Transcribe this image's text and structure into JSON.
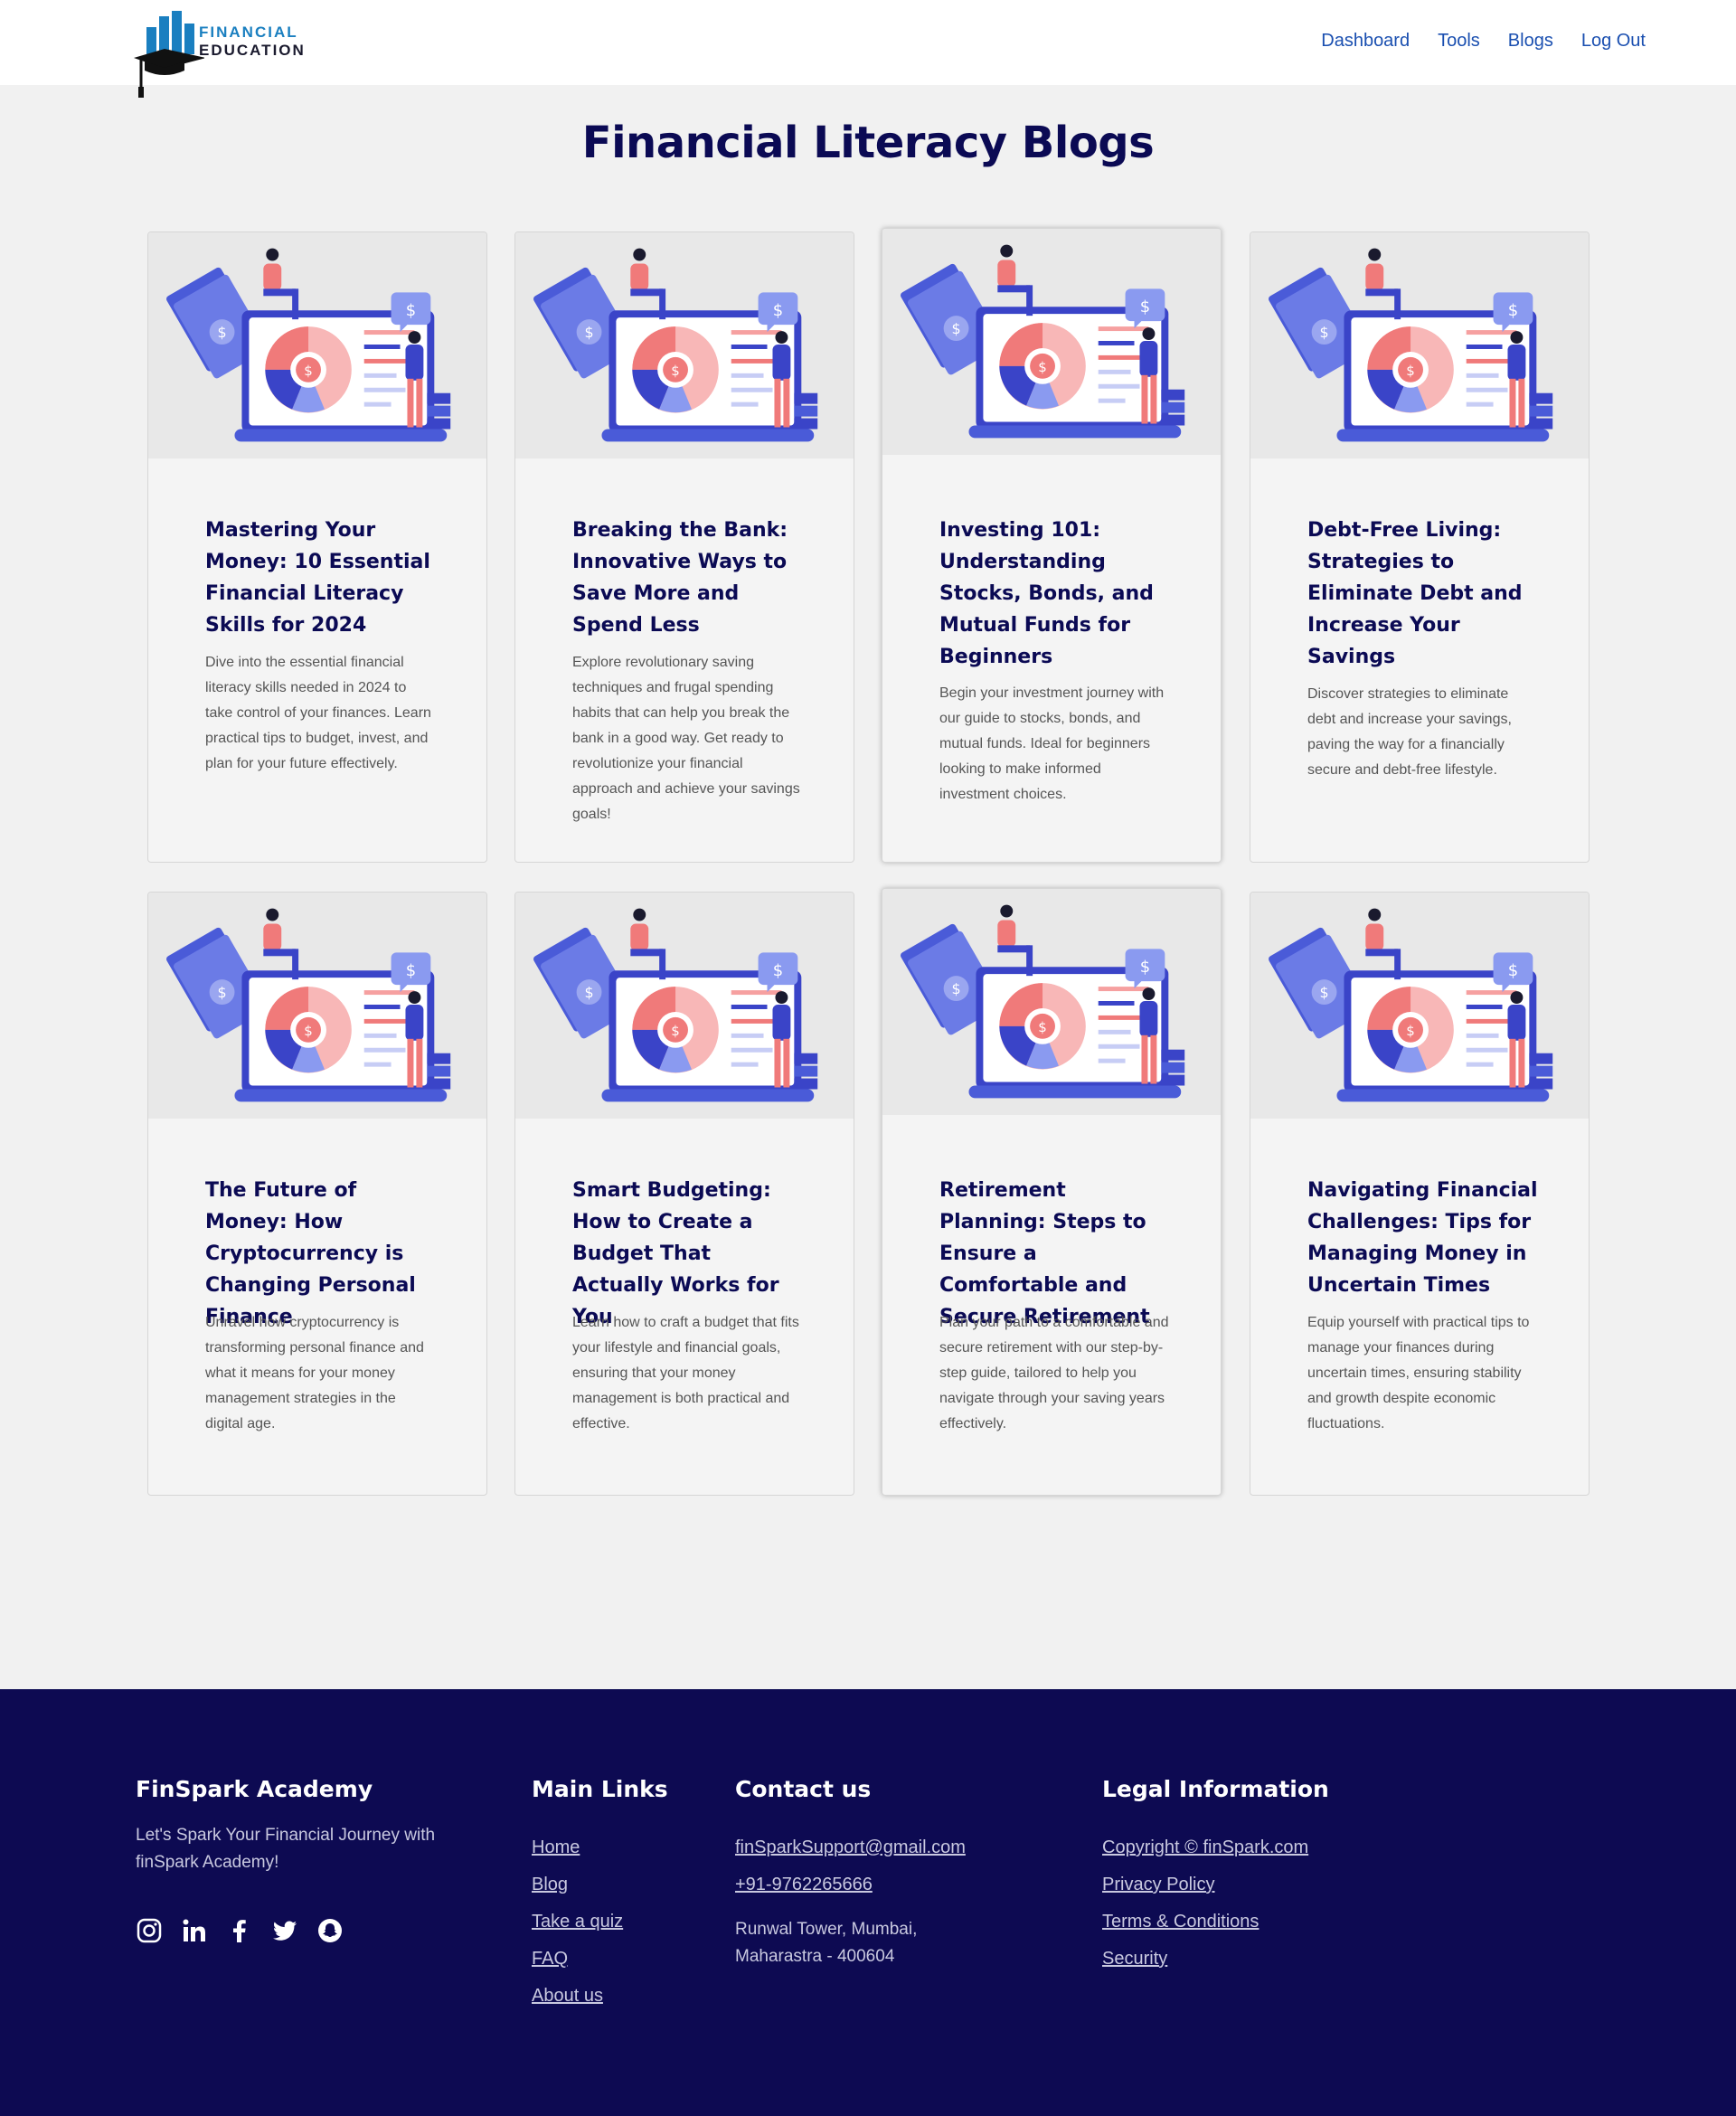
{
  "header": {
    "logo_line1": "FINANCIAL",
    "logo_line2": "EDUCATION",
    "nav": [
      "Dashboard",
      "Tools",
      "Blogs",
      "Log Out"
    ]
  },
  "page": {
    "title": "Financial Literacy Blogs"
  },
  "cards": [
    {
      "title": "Mastering Your Money: 10 Essential Financial Literacy Skills for 2024",
      "desc": "Dive into the essential financial literacy skills needed in 2024 to take control of your finances. Learn practical tips to budget, invest, and plan for your future effectively."
    },
    {
      "title": "Breaking the Bank: Innovative Ways to Save More and Spend Less",
      "desc": "Explore revolutionary saving techniques and frugal spending habits that can help you break the bank in a good way. Get ready to revolutionize your financial approach and achieve your savings goals!"
    },
    {
      "title": "Investing 101: Understanding Stocks, Bonds, and Mutual Funds for Beginners",
      "desc": "Begin your investment journey with our guide to stocks, bonds, and mutual funds. Ideal for beginners looking to make informed investment choices."
    },
    {
      "title": "Debt-Free Living: Strategies to Eliminate Debt and Increase Your Savings",
      "desc": "Discover strategies to eliminate debt and increase your savings, paving the way for a financially secure and debt-free lifestyle."
    },
    {
      "title": "The Future of Money: How Cryptocurrency is Changing Personal Finance",
      "desc": "Unravel how cryptocurrency is transforming personal finance and what it means for your money management strategies in the digital age."
    },
    {
      "title": "Smart Budgeting: How to Create a Budget That Actually Works for You",
      "desc": "Learn how to craft a budget that fits your lifestyle and financial goals, ensuring that your money management is both practical and effective."
    },
    {
      "title": "Retirement Planning: Steps to Ensure a Comfortable and Secure Retirement",
      "desc": "Plan your path to a comfortable and secure retirement with our step-by-step guide, tailored to help you navigate through your saving years effectively."
    },
    {
      "title": "Navigating Financial Challenges: Tips for Managing Money in Uncertain Times",
      "desc": "Equip yourself with practical tips to manage your finances during uncertain times, ensuring stability and growth despite economic fluctuations."
    }
  ],
  "footer": {
    "brand": "FinSpark Academy",
    "tagline": "Let's Spark Your Financial Journey with finSpark Academy!",
    "socials": [
      "instagram-icon",
      "linkedin-icon",
      "facebook-icon",
      "twitter-icon",
      "snapchat-icon"
    ],
    "main_links_title": "Main Links",
    "main_links": [
      "Home",
      "Blog",
      "Take a quiz",
      "FAQ",
      "About us"
    ],
    "contact_title": "Contact us",
    "email": "finSparkSupport@gmail.com",
    "phone": "+91-9762265666",
    "address_line1": "Runwal Tower, Mumbai,",
    "address_line2": "Maharastra - 400604",
    "legal_title": "Legal Information",
    "legal_links": [
      "Copyright © finSpark.com",
      "Privacy Policy",
      "Terms & Conditions",
      "Security"
    ]
  },
  "colors": {
    "navy": "#0b0a54",
    "footer_bg": "#0d0a52",
    "nav_link": "#1a4fb0",
    "logo_blue": "#1a7fc0",
    "illus_blue": "#4a5bd8",
    "illus_coral": "#f07a7a"
  }
}
